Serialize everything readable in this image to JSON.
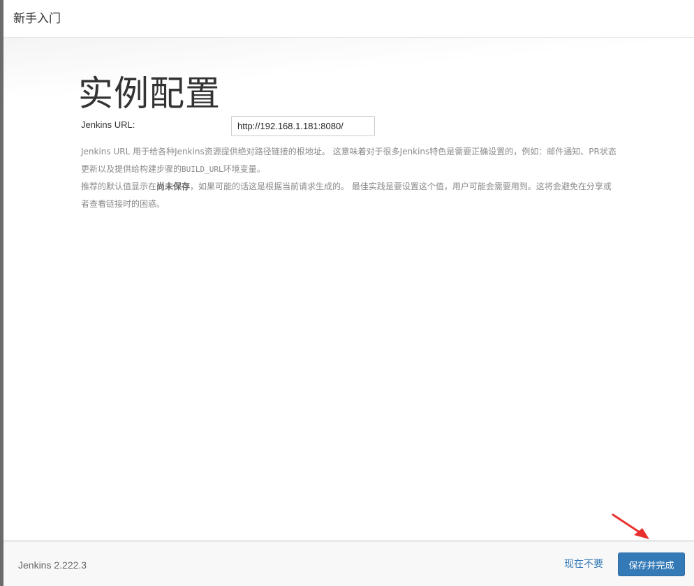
{
  "dialog": {
    "title": "新手入门"
  },
  "main": {
    "heading": "实例配置",
    "url_label": "Jenkins URL:",
    "url_value": "http://192.168.1.181:8080/",
    "help_line1": "Jenkins URL 用于给各种Jenkins资源提供绝对路径链接的根地址。 这意味着对于很多Jenkins特色是需要正确设置的，例如：邮件通知、PR状态更新以及提供给构建步骤的",
    "help_code": "BUILD_URL",
    "help_line1_end": "环境变量。",
    "help_line2_start": "推荐的默认值显示在",
    "help_bold": "尚未保存",
    "help_line2_end": "，如果可能的话这是根据当前请求生成的。 最佳实践是要设置这个值，用户可能会需要用到。这将会避免在分享或者查看链接时的困惑。"
  },
  "footer": {
    "version": "Jenkins 2.222.3",
    "skip_label": "现在不要",
    "save_label": "保存并完成"
  },
  "colors": {
    "primary": "#337ab7",
    "annotation_arrow": "#e8312f"
  }
}
